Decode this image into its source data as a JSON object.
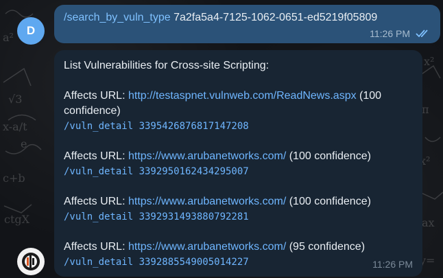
{
  "sender_avatar": {
    "initial": "D",
    "color": "#5fa8f0"
  },
  "outgoing": {
    "command": "/search_by_vuln_type",
    "argument": "7a2fa5a4-7125-1062-0651-ed5219f05809",
    "time": "11:26 PM"
  },
  "incoming": {
    "title": "List Vulnerabilities for Cross-site Scripting:",
    "items": [
      {
        "prefix": "Affects URL: ",
        "url": "http://testaspnet.vulnweb.com/ReadNews.aspx",
        "confidence": " (100 confidence)",
        "detail": "/vuln_detail 3395426876817147208"
      },
      {
        "prefix": "Affects URL: ",
        "url": "https://www.arubanetworks.com/",
        "confidence": " (100 confidence)",
        "detail": "/vuln_detail 3392950162434295007"
      },
      {
        "prefix": "Affects URL: ",
        "url": "https://www.arubanetworks.com/",
        "confidence": " (100 confidence)",
        "detail": "/vuln_detail 3392931493880792281"
      },
      {
        "prefix": "Affects URL: ",
        "url": "https://www.arubanetworks.com/",
        "confidence": " (95 confidence)",
        "detail": "/vuln_detail 3392885549005014227"
      }
    ],
    "time": "11:26 PM"
  },
  "colors": {
    "outgoing_bubble": "#2b5278",
    "incoming_bubble": "#182533",
    "link": "#6fb6ff"
  }
}
